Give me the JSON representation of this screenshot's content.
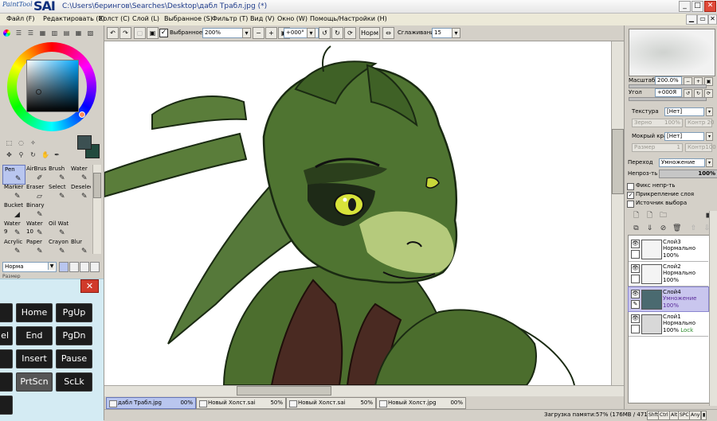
{
  "app": {
    "logo_small": "PaintTool",
    "logo_big": "SAI",
    "window_title": "C:\\Users\\берингов\\Searches\\Desktop\\дабл Трабл.jpg (*)"
  },
  "window_controls": {
    "minimize": "_",
    "maximize": "□",
    "close": "✕"
  },
  "menu": {
    "items": [
      {
        "label": "Файл (F)"
      },
      {
        "label": "Редактировать (E)"
      },
      {
        "label": "Холст (C)"
      },
      {
        "label": "Слой (L)"
      },
      {
        "label": "Выбранное (S)"
      },
      {
        "label": "Фильтр (T)"
      },
      {
        "label": "Вид (V)"
      },
      {
        "label": "Окно (W)"
      },
      {
        "label": "Помощь/Настройки (H)"
      }
    ]
  },
  "toolbar": {
    "selection_label": "Выбранное",
    "selection_checked": true,
    "zoom": "200%",
    "rotation": "+000°",
    "mode": "Норм",
    "stabilizer_label": "Сглаживание",
    "stabilizer_value": "15"
  },
  "tools": {
    "cells": [
      {
        "label": "Pen",
        "num": "",
        "icon": "pen-icon",
        "glyph": "✎"
      },
      {
        "label": "AirBrush",
        "num": "",
        "icon": "airbrush-icon",
        "glyph": "✐"
      },
      {
        "label": "Brush",
        "num": "",
        "icon": "brush-icon",
        "glyph": "✎"
      },
      {
        "label": "Water",
        "num": "",
        "icon": "water-icon",
        "glyph": "✎"
      },
      {
        "label": "Marker",
        "num": "",
        "icon": "marker-icon",
        "glyph": "✎"
      },
      {
        "label": "Eraser",
        "num": "",
        "icon": "eraser-icon",
        "glyph": "▱"
      },
      {
        "label": "Select",
        "num": "",
        "icon": "select-icon",
        "glyph": "✎"
      },
      {
        "label": "Deselect",
        "num": "",
        "icon": "deselect-icon",
        "glyph": "✎"
      },
      {
        "label": "Bucket",
        "num": "",
        "icon": "bucket-icon",
        "glyph": "◢"
      },
      {
        "label": "Binary",
        "num": "",
        "icon": "binary-icon",
        "glyph": "✎"
      },
      {
        "label": "",
        "num": "",
        "icon": "",
        "glyph": ""
      },
      {
        "label": "",
        "num": "",
        "icon": "",
        "glyph": ""
      },
      {
        "label": "Water",
        "num": "9",
        "icon": "water-icon",
        "glyph": "✎"
      },
      {
        "label": "Water",
        "num": "10",
        "icon": "water-icon",
        "glyph": "✎"
      },
      {
        "label": "Oil Wate",
        "num": "",
        "icon": "oil-water-icon",
        "glyph": "✎"
      },
      {
        "label": "",
        "num": "",
        "icon": "",
        "glyph": ""
      },
      {
        "label": "Acrylic",
        "num": "",
        "icon": "acrylic-icon",
        "glyph": "✎"
      },
      {
        "label": "Paper",
        "num": "",
        "icon": "paper-icon",
        "glyph": "✎"
      },
      {
        "label": "Crayon",
        "num": "",
        "icon": "crayon-icon",
        "glyph": "✎"
      },
      {
        "label": "Blur",
        "num": "",
        "icon": "blur-icon",
        "glyph": "✎"
      }
    ],
    "blend_mode": "Норма",
    "brush_partial": "Размер"
  },
  "colors": {
    "primary": "#3c5052",
    "secondary": "#224a3e",
    "accent_selection": "#b9c6ef",
    "layer_selected": "#c9c6ee"
  },
  "keyboard": {
    "close": "✕",
    "keys": [
      {
        "label": "",
        "name": "key-partial-1"
      },
      {
        "label": "Home",
        "name": "key-home"
      },
      {
        "label": "PgUp",
        "name": "key-pgup"
      },
      {
        "label": "el",
        "name": "key-delete"
      },
      {
        "label": "End",
        "name": "key-end"
      },
      {
        "label": "PgDn",
        "name": "key-pgdn"
      },
      {
        "label": "",
        "name": "key-partial-2"
      },
      {
        "label": "Insert",
        "name": "key-insert"
      },
      {
        "label": "Pause",
        "name": "key-pause"
      },
      {
        "label": "",
        "name": "key-partial-3"
      },
      {
        "label": "PrtScn",
        "name": "key-prtscn"
      },
      {
        "label": "ScLk",
        "name": "key-sclk"
      },
      {
        "label": "",
        "name": "key-partial-4"
      }
    ]
  },
  "tabs": [
    {
      "name": "дабл Трабл.jpg",
      "percent": "00%",
      "active": true
    },
    {
      "name": "Новый Холст.sai",
      "percent": "50%",
      "active": false
    },
    {
      "name": "Новый Холст.sai",
      "percent": "50%",
      "active": false
    },
    {
      "name": "Новый Холст.jpg",
      "percent": "00%",
      "active": false
    }
  ],
  "status": {
    "memory": "Загрузка памяти:57% (176MB / 471MB)",
    "keys": [
      "Shft",
      "Ctrl",
      "Alt",
      "SPC",
      "Any",
      "▮"
    ]
  },
  "right": {
    "zoom_label": "Масштаб",
    "zoom_value": "200.0%",
    "angle_label": "Угол",
    "angle_value": "+000Я",
    "texture_label": "Текстура",
    "texture_value": "[Нет]",
    "grain_label": "Зерно",
    "grain_value": "100%",
    "contrast_label": "Контр",
    "contrast_value": "20",
    "wet_edge_label": "Мокрый край",
    "wet_edge_value": "[Нет]",
    "size_label": "Размер",
    "size_value": "1",
    "contrast2_label": "Контр",
    "contrast2_value": "100",
    "blend_label": "Переход",
    "blend_value": "Умножение",
    "opacity_label": "Непроз-ть",
    "opacity_value": "100%",
    "fix_opacity_label": "Фикс непр-ть",
    "clip_label": "Прикрепление слоя",
    "source_label": "Источник выбора"
  },
  "layers": [
    {
      "name": "Слой3",
      "mode": "Нормально",
      "opacity": "100%",
      "lock": "",
      "selected": false
    },
    {
      "name": "Слой2",
      "mode": "Нормально",
      "opacity": "100%",
      "lock": "",
      "selected": false
    },
    {
      "name": "Слой4",
      "mode": "Умножение",
      "opacity": "100%",
      "lock": "",
      "selected": true
    },
    {
      "name": "Слой1",
      "mode": "Нормально",
      "opacity": "100%",
      "lock": "Lock",
      "selected": false
    }
  ]
}
